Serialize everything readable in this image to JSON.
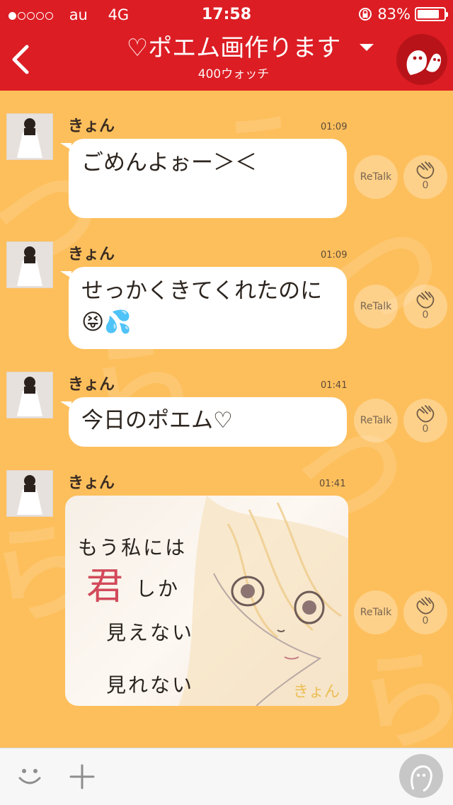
{
  "status": {
    "carrier": "au",
    "network": "4G",
    "time": "17:58",
    "battery": "83%",
    "battery_level": 0.83
  },
  "header": {
    "title": "♡ポエム画作ります",
    "subtitle": "400ウォッチ"
  },
  "messages": [
    {
      "name": "きょん",
      "time": "01:09",
      "text": "ごめんよぉー＞＜",
      "retalk": "ReTalk",
      "claps": "0"
    },
    {
      "name": "きょん",
      "time": "01:09",
      "text": "せっかくきてくれたのに",
      "emoji": "😝💦",
      "retalk": "ReTalk",
      "claps": "0"
    },
    {
      "name": "きょん",
      "time": "01:41",
      "text": "今日のポエム♡",
      "retalk": "ReTalk",
      "claps": "0"
    },
    {
      "name": "きょん",
      "time": "01:41",
      "retalk": "ReTalk",
      "claps": "0",
      "image": {
        "line1": "もう私には",
        "red": "君",
        "line2": "しか",
        "line3": "見えない",
        "line4": "見れない",
        "signature": "きょん"
      }
    }
  ],
  "colors": {
    "header": "#dc1d24",
    "background": "#fdbf5c",
    "bubble": "#ffffff"
  },
  "icons": {
    "back": "chevron-left-icon",
    "dropdown": "caret-down-icon",
    "mascot": "ghost-mascot-icon",
    "emoji": "smile-icon",
    "add": "plus-icon",
    "voice": "mic-icon",
    "clap": "clap-hands-icon"
  }
}
